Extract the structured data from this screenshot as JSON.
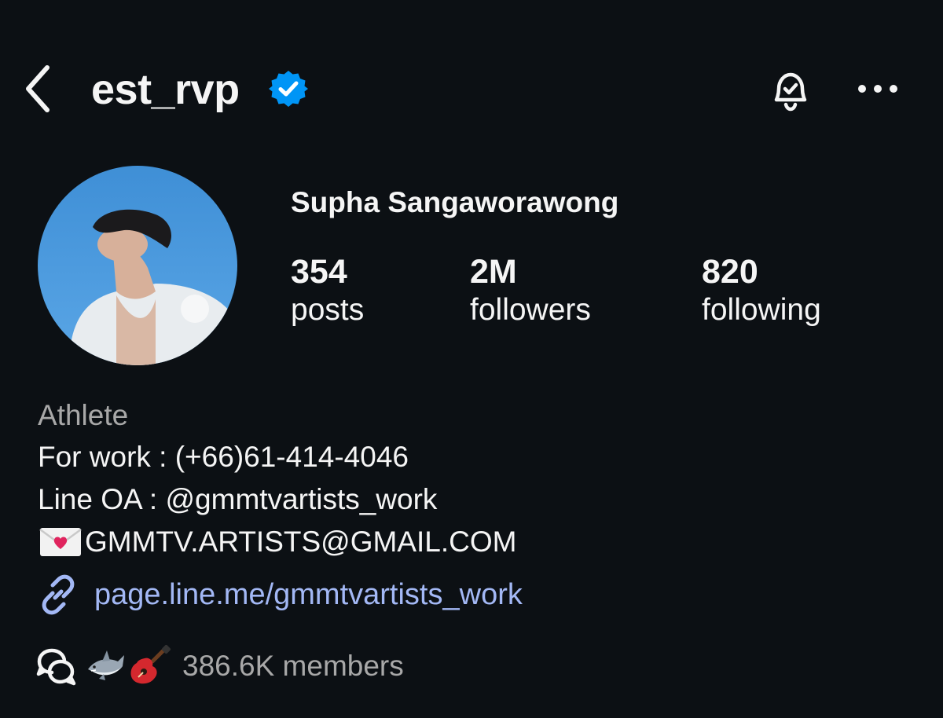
{
  "header": {
    "username": "est_rvp",
    "verified_icon": "verified-badge-icon",
    "back_icon": "chevron-left-icon",
    "notifications_icon": "bell-check-icon",
    "more_icon": "more-horizontal-icon"
  },
  "profile": {
    "full_name": "Supha Sangaworawong",
    "avatar": "profile-photo",
    "stats": [
      {
        "value": "354",
        "label": "posts"
      },
      {
        "value": "2M",
        "label": "followers"
      },
      {
        "value": "820",
        "label": "following"
      }
    ]
  },
  "bio": {
    "category": "Athlete",
    "lines": [
      "For work : (+66)61-414-4046",
      "Line OA : @gmmtvartists_work",
      "GMMTV.ARTISTS@GMAIL.COM"
    ],
    "email_icon": "love-letter-emoji",
    "link": "page.line.me/gmmtvartists_work",
    "link_icon": "link-icon"
  },
  "channel": {
    "icon": "broadcast-channel-icon",
    "emojis": [
      "shark-emoji",
      "guitar-emoji"
    ],
    "members": "386.6K members"
  },
  "colors": {
    "background": "#0c1014",
    "text": "#f5f5f5",
    "secondary_text": "#a8a8a8",
    "link": "#a3b8f5",
    "verified": "#0095f6"
  }
}
